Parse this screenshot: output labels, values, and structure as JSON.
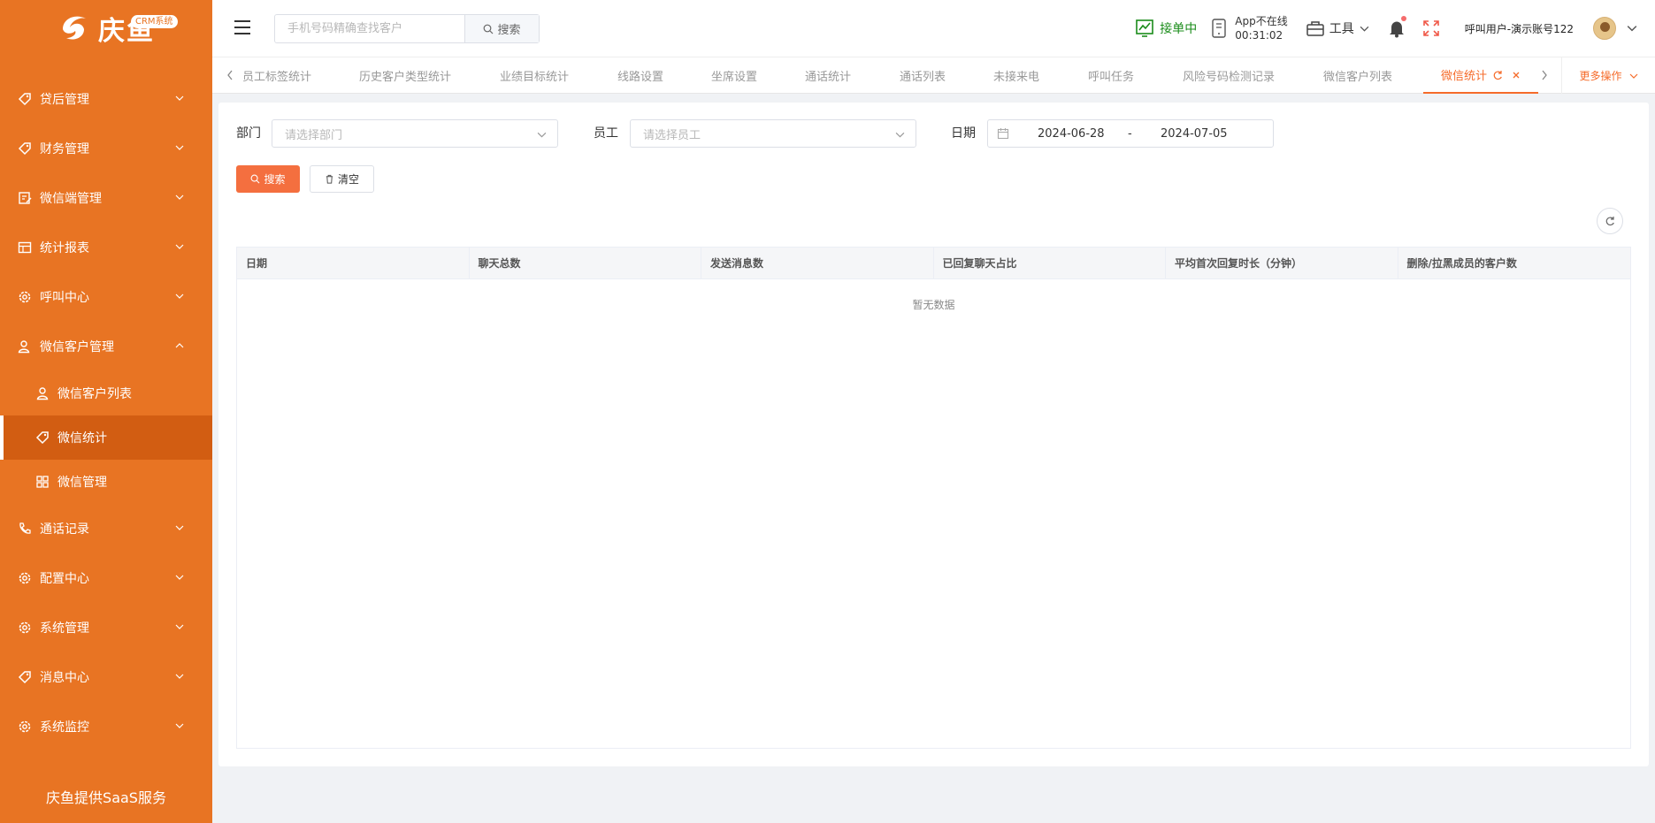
{
  "brand": {
    "name": "庆鱼",
    "tag": "CRM系统",
    "accent": "#e87423"
  },
  "sidebar": {
    "items": [
      {
        "label": "贷后管理",
        "icon": "tag-icon",
        "expanded": false
      },
      {
        "label": "财务管理",
        "icon": "tag-icon",
        "expanded": false
      },
      {
        "label": "微信端管理",
        "icon": "edit-icon",
        "expanded": false
      },
      {
        "label": "统计报表",
        "icon": "table-icon",
        "expanded": false
      },
      {
        "label": "呼叫中心",
        "icon": "gear-icon",
        "expanded": false
      },
      {
        "label": "微信客户管理",
        "icon": "user-icon",
        "expanded": true
      }
    ],
    "sub_items": [
      {
        "label": "微信客户列表",
        "icon": "user-icon",
        "active": false
      },
      {
        "label": "微信统计",
        "icon": "tag-icon",
        "active": true
      },
      {
        "label": "微信管理",
        "icon": "grid-icon",
        "active": false
      }
    ],
    "items_after": [
      {
        "label": "通话记录",
        "icon": "phone-icon"
      },
      {
        "label": "配置中心",
        "icon": "gear-icon"
      },
      {
        "label": "系统管理",
        "icon": "gear-icon"
      },
      {
        "label": "消息中心",
        "icon": "tag-icon"
      },
      {
        "label": "系统监控",
        "icon": "gear-icon"
      }
    ],
    "footer": "庆鱼提供SaaS服务"
  },
  "header": {
    "search_placeholder": "手机号码精确查找客户",
    "search_button": "搜索",
    "status": "接单中",
    "app_status": "App不在线",
    "app_timer": "00:31:02",
    "tools": "工具",
    "user": "呼叫用户-演示账号122"
  },
  "tabs": [
    "员工标签统计",
    "历史客户类型统计",
    "业绩目标统计",
    "线路设置",
    "坐席设置",
    "通话统计",
    "通话列表",
    "未接来电",
    "呼叫任务",
    "风险号码检测记录",
    "微信客户列表",
    "微信统计"
  ],
  "more_ops": "更多操作",
  "filters": {
    "dept_label": "部门",
    "dept_placeholder": "请选择部门",
    "staff_label": "员工",
    "staff_placeholder": "请选择员工",
    "date_label": "日期",
    "date_start": "2024-06-28",
    "date_sep": "-",
    "date_end": "2024-07-05",
    "search_button": "搜索",
    "clear_button": "清空"
  },
  "table": {
    "columns": [
      "日期",
      "聊天总数",
      "发送消息数",
      "已回复聊天占比",
      "平均首次回复时长（分钟）",
      "删除/拉黑成员的客户数"
    ],
    "empty_text": "暂无数据"
  }
}
